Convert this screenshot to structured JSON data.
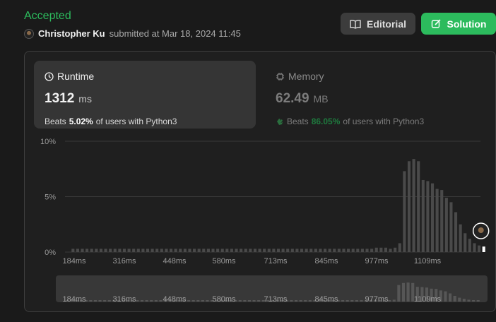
{
  "header": {
    "status": "Accepted",
    "user": "Christopher Ku",
    "submitted_text": "submitted at Mar 18, 2024 11:45",
    "editorial_label": "Editorial",
    "solution_label": "Solution"
  },
  "runtime": {
    "title": "Runtime",
    "value": "1312",
    "unit": "ms",
    "beats_label": "Beats",
    "beats_pct": "5.02%",
    "beats_suffix": "of users with Python3"
  },
  "memory": {
    "title": "Memory",
    "value": "62.49",
    "unit": "MB",
    "beats_label": "Beats",
    "beats_pct": "86.05%",
    "beats_suffix": "of users with Python3"
  },
  "colors": {
    "accent": "#2cbb5d",
    "bar": "#4a4a4a",
    "bar_highlight": "#ffffff"
  },
  "chart_data": {
    "type": "bar",
    "y_ticks": [
      "10%",
      "5%",
      "0%"
    ],
    "ylim": [
      0,
      10
    ],
    "x_ticks": [
      "184ms",
      "316ms",
      "448ms",
      "580ms",
      "713ms",
      "845ms",
      "977ms",
      "1109ms"
    ],
    "values": [
      0.3,
      0.3,
      0.3,
      0.3,
      0.3,
      0.3,
      0.3,
      0.3,
      0.3,
      0.3,
      0.3,
      0.3,
      0.3,
      0.3,
      0.3,
      0.3,
      0.3,
      0.3,
      0.3,
      0.3,
      0.3,
      0.3,
      0.3,
      0.3,
      0.3,
      0.3,
      0.3,
      0.3,
      0.3,
      0.3,
      0.3,
      0.3,
      0.3,
      0.3,
      0.3,
      0.3,
      0.3,
      0.3,
      0.3,
      0.3,
      0.3,
      0.3,
      0.3,
      0.3,
      0.3,
      0.3,
      0.3,
      0.3,
      0.3,
      0.3,
      0.3,
      0.3,
      0.3,
      0.3,
      0.3,
      0.3,
      0.3,
      0.3,
      0.3,
      0.3,
      0.3,
      0.3,
      0.3,
      0.3,
      0.3,
      0.4,
      0.4,
      0.4,
      0.3,
      0.4,
      0.8,
      7.3,
      8.2,
      8.4,
      8.2,
      6.5,
      6.4,
      6.2,
      5.7,
      5.6,
      4.9,
      4.5,
      3.6,
      2.5,
      1.7,
      1.2,
      0.8,
      0.6,
      0.5
    ],
    "highlight_value": 0.5
  }
}
